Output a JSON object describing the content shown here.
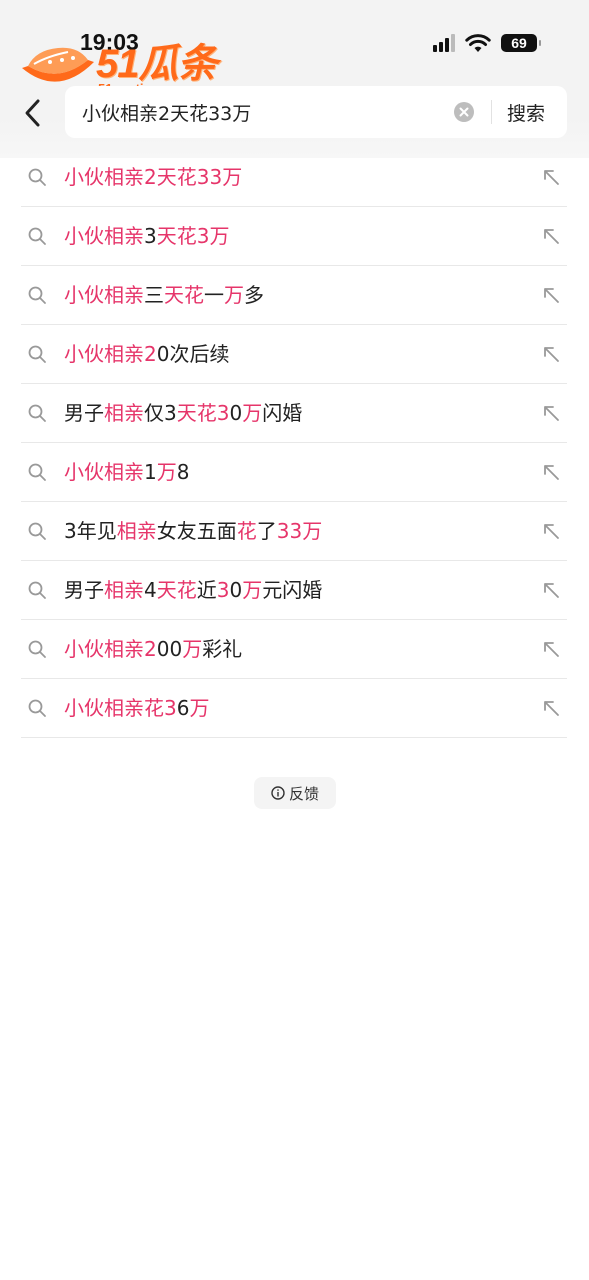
{
  "status_bar": {
    "time": "19:03",
    "battery": "69"
  },
  "watermark": {
    "logo_text": "51瓜条",
    "domain": "51guatiao.com"
  },
  "search": {
    "query": "小伙相亲2天花33万",
    "button_label": "搜索"
  },
  "suggestions": [
    {
      "segments": [
        {
          "t": "小伙相亲",
          "hl": true
        },
        {
          "t": "2",
          "hl": true
        },
        {
          "t": "天花",
          "hl": true
        },
        {
          "t": "33",
          "hl": true
        },
        {
          "t": "万",
          "hl": true
        }
      ]
    },
    {
      "segments": [
        {
          "t": "小伙相亲",
          "hl": true
        },
        {
          "t": "3",
          "hl": false
        },
        {
          "t": "天花",
          "hl": true
        },
        {
          "t": "3",
          "hl": true
        },
        {
          "t": "万",
          "hl": true
        }
      ]
    },
    {
      "segments": [
        {
          "t": "小伙相亲",
          "hl": true
        },
        {
          "t": "三",
          "hl": false
        },
        {
          "t": "天花",
          "hl": true
        },
        {
          "t": "一",
          "hl": false
        },
        {
          "t": "万",
          "hl": true
        },
        {
          "t": "多",
          "hl": false
        }
      ]
    },
    {
      "segments": [
        {
          "t": "小伙相亲",
          "hl": true
        },
        {
          "t": "2",
          "hl": true
        },
        {
          "t": "0次后续",
          "hl": false
        }
      ]
    },
    {
      "segments": [
        {
          "t": "男子",
          "hl": false
        },
        {
          "t": "相亲",
          "hl": true
        },
        {
          "t": "仅3",
          "hl": false
        },
        {
          "t": "天花",
          "hl": true
        },
        {
          "t": "3",
          "hl": true
        },
        {
          "t": "0",
          "hl": false
        },
        {
          "t": "万",
          "hl": true
        },
        {
          "t": "闪婚",
          "hl": false
        }
      ]
    },
    {
      "segments": [
        {
          "t": "小伙相亲",
          "hl": true
        },
        {
          "t": "1",
          "hl": false
        },
        {
          "t": "万",
          "hl": true
        },
        {
          "t": "8",
          "hl": false
        }
      ]
    },
    {
      "segments": [
        {
          "t": "3年见",
          "hl": false
        },
        {
          "t": "相亲",
          "hl": true
        },
        {
          "t": "女友五面",
          "hl": false
        },
        {
          "t": "花",
          "hl": true
        },
        {
          "t": "了",
          "hl": false
        },
        {
          "t": "33",
          "hl": true
        },
        {
          "t": "万",
          "hl": true
        }
      ]
    },
    {
      "segments": [
        {
          "t": "男子",
          "hl": false
        },
        {
          "t": "相亲",
          "hl": true
        },
        {
          "t": "4",
          "hl": false
        },
        {
          "t": "天花",
          "hl": true
        },
        {
          "t": "近",
          "hl": false
        },
        {
          "t": "3",
          "hl": true
        },
        {
          "t": "0",
          "hl": false
        },
        {
          "t": "万",
          "hl": true
        },
        {
          "t": "元闪婚",
          "hl": false
        }
      ]
    },
    {
      "segments": [
        {
          "t": "小伙相亲",
          "hl": true
        },
        {
          "t": "2",
          "hl": true
        },
        {
          "t": "00",
          "hl": false
        },
        {
          "t": "万",
          "hl": true
        },
        {
          "t": "彩礼",
          "hl": false
        }
      ]
    },
    {
      "segments": [
        {
          "t": "小伙相亲",
          "hl": true
        },
        {
          "t": "花",
          "hl": true
        },
        {
          "t": "3",
          "hl": true
        },
        {
          "t": "6",
          "hl": false
        },
        {
          "t": "万",
          "hl": true
        }
      ]
    }
  ],
  "feedback": {
    "label": "反馈"
  },
  "colors": {
    "highlight": "#e6356a",
    "text": "#222222",
    "watermark": "#ff6a1a"
  },
  "icons": {
    "back": "chevron-left-icon",
    "clear": "clear-circle-icon",
    "suggestion": "search-icon",
    "fill": "arrow-up-left-icon",
    "feedback": "info-circle-icon"
  }
}
